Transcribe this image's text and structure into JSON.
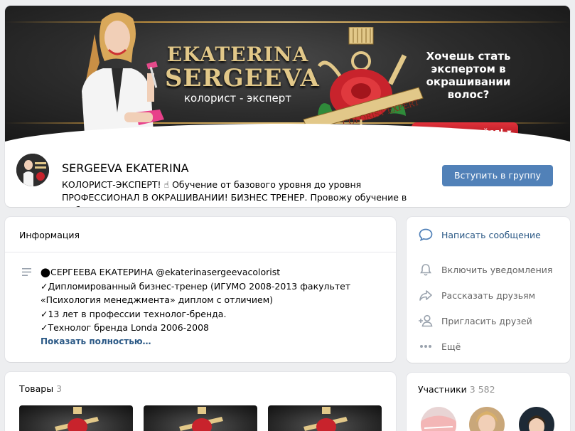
{
  "cover": {
    "brand_line1": "EKATERINA",
    "brand_line2": "SERGEEVA",
    "brand_subtitle": "колорист - эксперт",
    "promo_text": "Хочешь стать экспертом в окрашивании волос?",
    "subscribe_label": "▾ подписывайся! ▾",
    "ribbon_text": "COLORIST EXPERT",
    "accent_gold": "#e2c889",
    "accent_red": "#c8232c"
  },
  "group": {
    "name": "SERGEEVA EKATERINA",
    "status": "КОЛОРИСТ-ЭКСПЕРТ! ☝ Обучение от базового уровня до уровня ПРОФЕССИОНАЛ В ОКРАШИВАНИИ! БИЗНЕС ТРЕНЕР. Провожу обучение в любом городе!",
    "join_label": "Вступить в группу"
  },
  "info": {
    "title": "Информация",
    "lines": [
      "⬤СЕРГЕЕВА ЕКАТЕРИНА @ekaterinasergeevacolorist",
      "✓Дипломированный бизнес-тренер (ИГУМО 2008-2013 факультет",
      "«Психология менеджмента» диплом с отличием)",
      "✓13 лет в профессии технолог-бренда.",
      "✓Технолог бренда Londa 2006-2008"
    ],
    "more_label": "Показать полностью…"
  },
  "actions": [
    {
      "label": "Написать сообщение",
      "icon": "message-icon"
    },
    {
      "label": "Включить уведомления",
      "icon": "bell-icon"
    },
    {
      "label": "Рассказать друзьям",
      "icon": "share-icon"
    },
    {
      "label": "Пригласить друзей",
      "icon": "add-user-icon"
    },
    {
      "label": "Ещё",
      "icon": "more-icon"
    }
  ],
  "goods": {
    "title": "Товары",
    "count": "3"
  },
  "members": {
    "title": "Участники",
    "count": "3 582"
  },
  "colors": {
    "link": "#2a5885",
    "button": "#5181b8",
    "page_bg": "#edeef0"
  }
}
